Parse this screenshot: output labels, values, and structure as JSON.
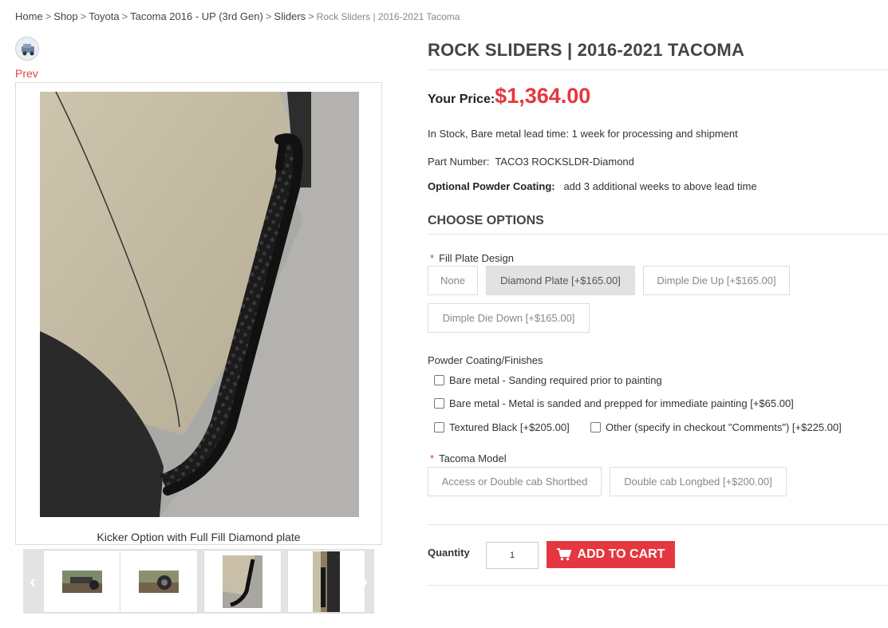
{
  "breadcrumb": {
    "items": [
      "Home",
      "Shop",
      "Toyota",
      "Tacoma 2016 - UP (3rd Gen)",
      "Sliders"
    ],
    "current": "Rock Sliders | 2016-2021 Tacoma",
    "separator": ">"
  },
  "gallery": {
    "prev_label": "Prev",
    "caption": "Kicker Option with Full Fill Diamond plate",
    "thumb_prev_icon": "‹",
    "thumb_next_icon": "›"
  },
  "product": {
    "title": "ROCK SLIDERS | 2016-2021 TACOMA",
    "price_label": "Your Price:",
    "price": "$1,364.00",
    "stock": "In Stock, Bare metal lead time: 1 week for processing and shipment",
    "part_number_label": "Part Number:",
    "part_number": "TACO3 ROCKSLDR-Diamond",
    "powder_label": "Optional Powder Coating:",
    "powder_text": "add 3 additional weeks to above lead time"
  },
  "options": {
    "heading": "CHOOSE OPTIONS",
    "fill_plate": {
      "label": "Fill Plate Design",
      "required_mark": "*",
      "choices": [
        "None",
        "Diamond Plate [+$165.00]",
        "Dimple Die Up [+$165.00]",
        "Dimple Die Down [+$165.00]"
      ],
      "selected": "Diamond Plate [+$165.00]"
    },
    "finishes": {
      "label": "Powder Coating/Finishes",
      "choices": [
        "Bare metal - Sanding required prior to painting",
        "Bare metal - Metal is sanded and prepped for immediate painting [+$65.00]",
        "Textured Black [+$205.00]",
        "Other (specify in checkout \"Comments\") [+$225.00]"
      ]
    },
    "model": {
      "label": "Tacoma Model",
      "required_mark": "*",
      "choices": [
        "Access or Double cab Shortbed",
        "Double cab Longbed [+$200.00]"
      ]
    }
  },
  "cart": {
    "quantity_label": "Quantity",
    "quantity_value": "1",
    "add_label": "ADD TO CART"
  },
  "colors": {
    "accent": "#e5373f",
    "selected_option_bg": "#e2e2e2"
  }
}
